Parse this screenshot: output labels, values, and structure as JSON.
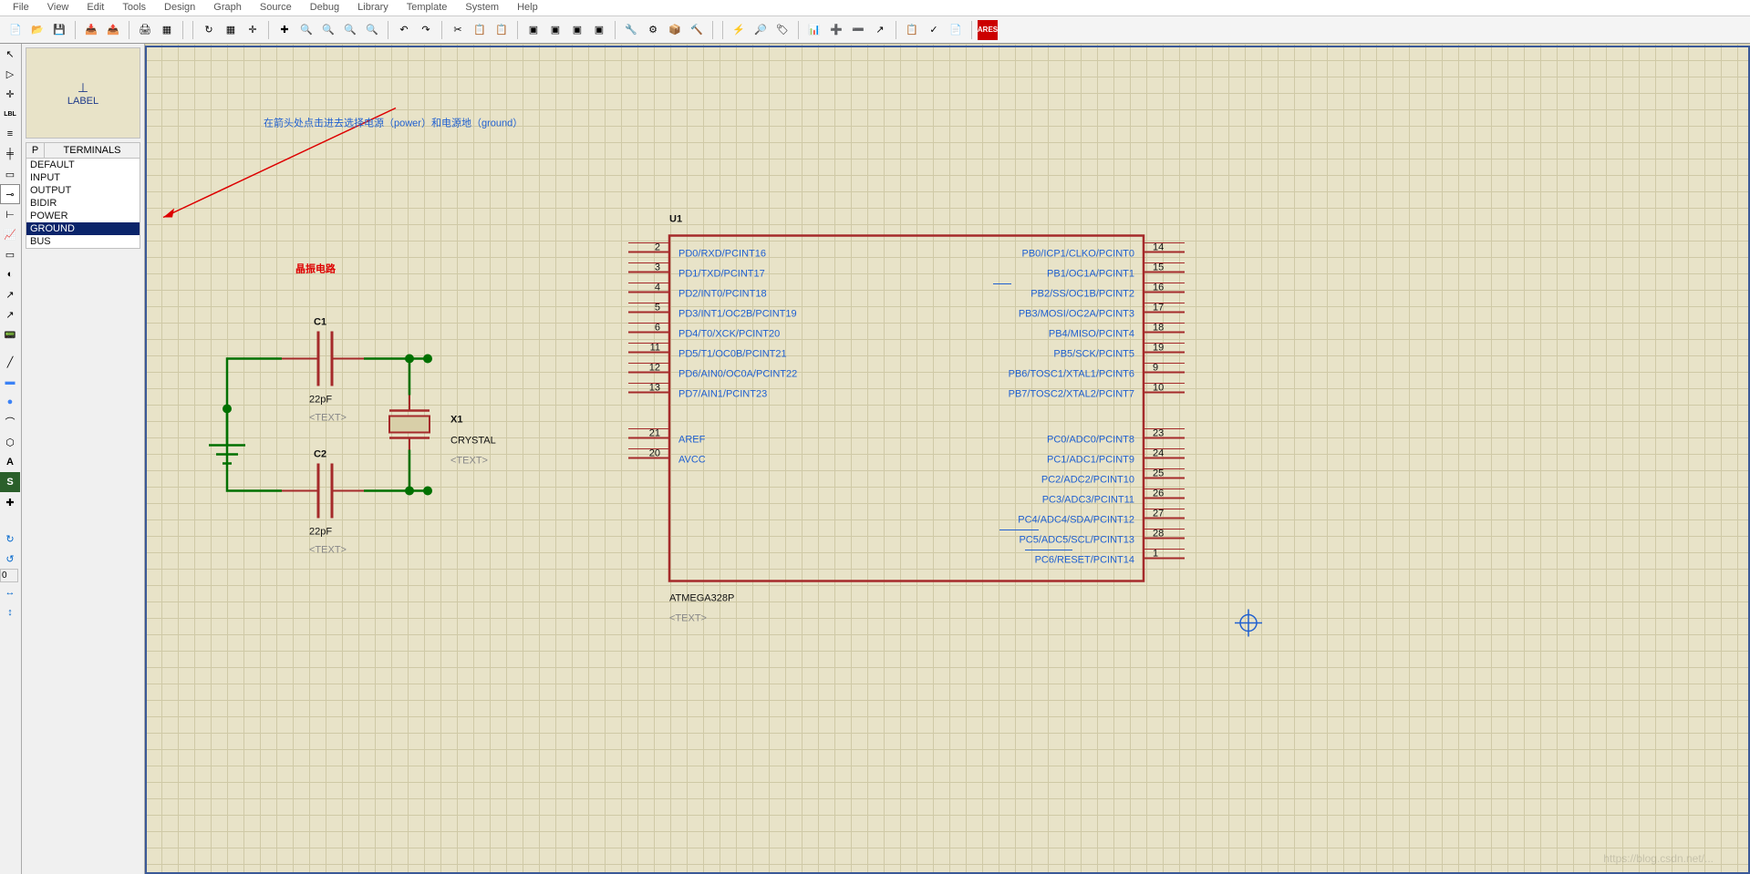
{
  "menu": [
    "File",
    "View",
    "Edit",
    "Tools",
    "Design",
    "Graph",
    "Source",
    "Debug",
    "Library",
    "Template",
    "System",
    "Help"
  ],
  "preview": {
    "label": "LABEL",
    "symbol": "⊥"
  },
  "listHeader": {
    "p": "P",
    "title": "TERMINALS"
  },
  "terminals": [
    "DEFAULT",
    "INPUT",
    "OUTPUT",
    "BIDIR",
    "POWER",
    "GROUND",
    "BUS"
  ],
  "terminalsSelected": 5,
  "spinValue": "0",
  "annotation": "在箭头处点击进去选择电源（power）和电源地（ground）",
  "crystal": {
    "heading": "晶振电路",
    "c1": {
      "name": "C1",
      "value": "22pF",
      "text": "<TEXT>"
    },
    "c2": {
      "name": "C2",
      "value": "22pF",
      "text": "<TEXT>"
    },
    "x1": {
      "name": "X1",
      "value": "CRYSTAL",
      "text": "<TEXT>"
    }
  },
  "chip": {
    "ref": "U1",
    "part": "ATMEGA328P",
    "text": "<TEXT>",
    "leftPins": [
      {
        "n": "2",
        "l": "PD0/RXD/PCINT16"
      },
      {
        "n": "3",
        "l": "PD1/TXD/PCINT17"
      },
      {
        "n": "4",
        "l": "PD2/INT0/PCINT18"
      },
      {
        "n": "5",
        "l": "PD3/INT1/OC2B/PCINT19"
      },
      {
        "n": "6",
        "l": "PD4/T0/XCK/PCINT20"
      },
      {
        "n": "11",
        "l": "PD5/T1/OC0B/PCINT21"
      },
      {
        "n": "12",
        "l": "PD6/AIN0/OC0A/PCINT22"
      },
      {
        "n": "13",
        "l": "PD7/AIN1/PCINT23"
      },
      {
        "n": "21",
        "l": "AREF"
      },
      {
        "n": "20",
        "l": "AVCC"
      }
    ],
    "rightPins": [
      {
        "n": "14",
        "l": "PB0/ICP1/CLKO/PCINT0"
      },
      {
        "n": "15",
        "l": "PB1/OC1A/PCINT1"
      },
      {
        "n": "16",
        "l": "PB2/SS/OC1B/PCINT2"
      },
      {
        "n": "17",
        "l": "PB3/MOSI/OC2A/PCINT3"
      },
      {
        "n": "18",
        "l": "PB4/MISO/PCINT4"
      },
      {
        "n": "19",
        "l": "PB5/SCK/PCINT5"
      },
      {
        "n": "9",
        "l": "PB6/TOSC1/XTAL1/PCINT6"
      },
      {
        "n": "10",
        "l": "PB7/TOSC2/XTAL2/PCINT7"
      },
      {
        "n": "23",
        "l": "PC0/ADC0/PCINT8"
      },
      {
        "n": "24",
        "l": "PC1/ADC1/PCINT9"
      },
      {
        "n": "25",
        "l": "PC2/ADC2/PCINT10"
      },
      {
        "n": "26",
        "l": "PC3/ADC3/PCINT11"
      },
      {
        "n": "27",
        "l": "PC4/ADC4/SDA/PCINT12"
      },
      {
        "n": "28",
        "l": "PC5/ADC5/SCL/PCINT13"
      },
      {
        "n": "1",
        "l": "PC6/RESET/PCINT14"
      }
    ]
  }
}
